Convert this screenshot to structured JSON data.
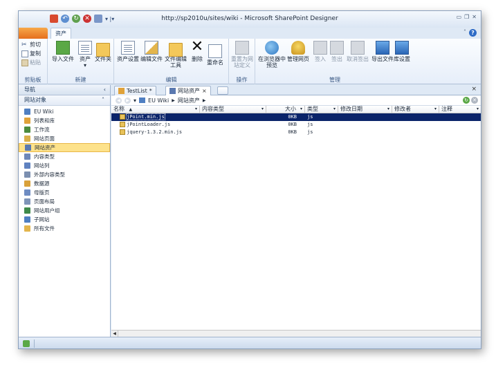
{
  "window": {
    "title": "http://sp2010u/sites/wiki  -  Microsoft SharePoint Designer"
  },
  "qat": {
    "icons": [
      "save-icon",
      "undo-icon",
      "refresh-icon",
      "stop-icon",
      "view-icon",
      "customize-icon"
    ],
    "more": "▾ |▾"
  },
  "window_controls": {
    "minimize": "▭",
    "restore": "❐",
    "close": "✕"
  },
  "ribbon_tabs": {
    "file": "",
    "assets": "资产"
  },
  "ribbon": {
    "clipboard": {
      "cut": "剪切",
      "copy": "复制",
      "paste": "粘贴",
      "label": "剪贴板"
    },
    "new": {
      "import": "导入文件",
      "asset": "资产",
      "folder": "文件夹",
      "label": "新建"
    },
    "edit": {
      "asset_settings": "资产设置",
      "edit_file": "编辑文件",
      "edit_tool": "文件编辑工具",
      "delete": "删除",
      "rename": "重命名",
      "label": "编辑"
    },
    "actions": {
      "reset": "重置为网站定义",
      "label": "操作"
    },
    "manage": {
      "preview": "在浏览器中预览",
      "admin_page": "管理网页",
      "check_in": "签入",
      "check_out": "签出",
      "undo_check_out": "取消签出",
      "export": "导出文件",
      "library_settings": "库设置",
      "label": "管理"
    }
  },
  "nav": {
    "header": "导航",
    "collapse": "‹",
    "section": "网站对象",
    "section_chevron": "˄",
    "items": [
      {
        "label": "EU Wiki",
        "icon": "home-icon",
        "color": "#4f7fc2"
      },
      {
        "label": "列表和库",
        "icon": "lists-icon",
        "color": "#e0a23a"
      },
      {
        "label": "工作流",
        "icon": "workflow-icon",
        "color": "#4c8b3e"
      },
      {
        "label": "网站页面",
        "icon": "pages-icon",
        "color": "#d9b04a"
      },
      {
        "label": "网站资产",
        "icon": "assets-icon",
        "color": "#5a79b0"
      },
      {
        "label": "内容类型",
        "icon": "content-types-icon",
        "color": "#6d87b8"
      },
      {
        "label": "网站列",
        "icon": "columns-icon",
        "color": "#5f82c0"
      },
      {
        "label": "外部内容类型",
        "icon": "external-content-icon",
        "color": "#7b8fb0"
      },
      {
        "label": "数据源",
        "icon": "datasource-icon",
        "color": "#d9a13a"
      },
      {
        "label": "母版页",
        "icon": "master-page-icon",
        "color": "#6e8cc2"
      },
      {
        "label": "页面布局",
        "icon": "page-layout-icon",
        "color": "#7f94b8"
      },
      {
        "label": "网站用户组",
        "icon": "groups-icon",
        "color": "#3f8a4a"
      },
      {
        "label": "子网站",
        "icon": "subsites-icon",
        "color": "#4f7fc2"
      },
      {
        "label": "所有文件",
        "icon": "all-files-icon",
        "color": "#e3b54c"
      }
    ],
    "active_index": 4
  },
  "doc_tabs": {
    "tab1": "TestList",
    "tab1_marker": "*",
    "tab2": "网站资产",
    "tab_close": "×",
    "pane_close": "×"
  },
  "breadcrumb": {
    "back": "◀",
    "forward": "▶",
    "dropdown": "▾",
    "items": [
      "EU Wiki",
      "网站资产"
    ],
    "separator": "▶"
  },
  "grid": {
    "columns": [
      "名称",
      "内容类型",
      "大小",
      "类型",
      "修改日期",
      "修改者",
      "注释"
    ],
    "sort_marker": "▲",
    "rows": [
      {
        "name": "jPoint.min.js",
        "content_type": "",
        "size": "0KB",
        "type": "js",
        "modified": "",
        "modified_by": "",
        "comment": ""
      },
      {
        "name": "jPointLoader.js",
        "content_type": "",
        "size": "0KB",
        "type": "js",
        "modified": "",
        "modified_by": "",
        "comment": ""
      },
      {
        "name": "jquery-1.3.2.min.js",
        "content_type": "",
        "size": "0KB",
        "type": "js",
        "modified": "",
        "modified_by": "",
        "comment": ""
      }
    ],
    "selected_index": 0
  },
  "colors": {
    "selected_row": "#0a246a",
    "active_nav": "#fde28b",
    "file_tab": "#e56f1c"
  }
}
